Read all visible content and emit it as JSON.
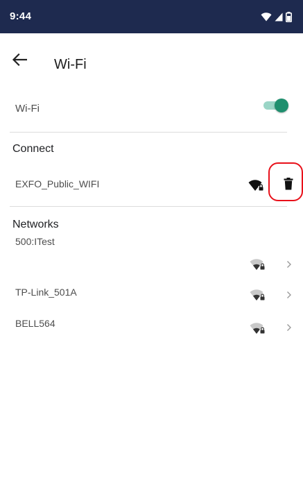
{
  "status_bar": {
    "time": "9:44",
    "background": "#1e2a4f",
    "icons": [
      "wifi-icon",
      "cell-signal-icon",
      "battery-icon"
    ]
  },
  "app_bar": {
    "title": "Wi-Fi",
    "back_icon": "arrow-left-icon"
  },
  "wifi_toggle": {
    "label": "Wi-Fi",
    "enabled": true,
    "accent": "#1f8f6e"
  },
  "connect": {
    "header": "Connect",
    "network": {
      "ssid": "EXFO_Public_WIFI",
      "icon": "wifi-lock-icon",
      "action_icon": "trash-icon"
    }
  },
  "networks": {
    "header": "Networks",
    "items": [
      {
        "ssid": "500:ITest",
        "icon": "wifi-lock-icon"
      },
      {
        "ssid": "TP-Link_501A",
        "icon": "wifi-lock-icon"
      },
      {
        "ssid": "BELL564",
        "icon": "wifi-lock-icon"
      }
    ]
  },
  "annotation": {
    "color": "#e8101a"
  }
}
